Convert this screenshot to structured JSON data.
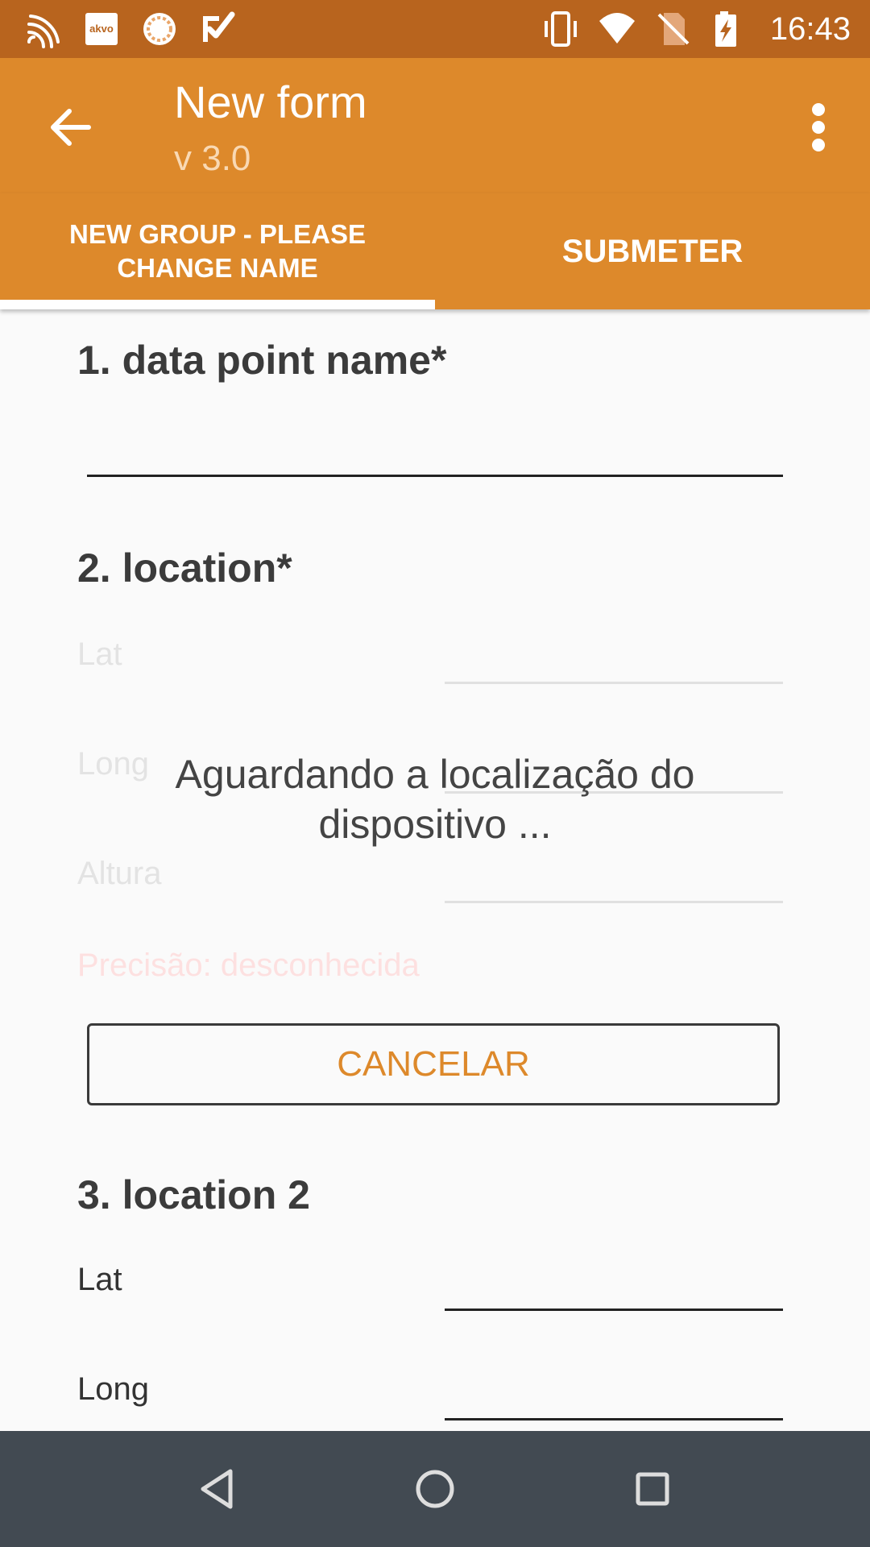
{
  "status_bar": {
    "time": "16:43",
    "left_icons": [
      "wifi-signal-icon",
      "akvo-icon",
      "sync-icon",
      "check-icon"
    ],
    "right_icons": [
      "vibrate-icon",
      "wifi-icon",
      "no-sim-icon",
      "battery-charging-icon"
    ],
    "akvo_text": "akvo"
  },
  "app_bar": {
    "title": "New form",
    "subtitle": "v 3.0"
  },
  "tabs": [
    {
      "label": "NEW GROUP - PLEASE CHANGE NAME",
      "selected": true
    },
    {
      "label": "SUBMETER",
      "selected": false
    }
  ],
  "questions": {
    "q1": {
      "title": "1. data point name*",
      "value": ""
    },
    "q2": {
      "title": "2. location*",
      "lat_label": "Lat",
      "long_label": "Long",
      "altitude_label": "Altura",
      "precision": "Precisão: desconhecida",
      "cancel_label": "CANCELAR"
    },
    "q3": {
      "title": "3. location 2",
      "lat_label": "Lat",
      "long_label": "Long"
    }
  },
  "waiting_message": "Aguardando a localização do dispositivo ...",
  "colors": {
    "status_bar": "#b8641e",
    "app_bar": "#dd892b",
    "accent": "#dd892b",
    "nav_bar": "#424a52"
  }
}
